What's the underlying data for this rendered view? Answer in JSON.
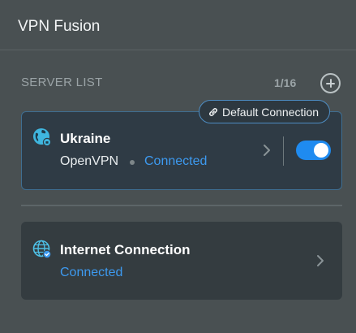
{
  "header": {
    "title": "VPN Fusion"
  },
  "server_list": {
    "label": "SERVER LIST",
    "count": "1/16",
    "add_icon": "plus-circle-icon"
  },
  "default_badge": {
    "label": "Default Connection",
    "icon": "link-icon"
  },
  "servers": [
    {
      "name": "Ukraine",
      "protocol": "OpenVPN",
      "status": "Connected",
      "icon": "globe-vpn-icon",
      "enabled": true
    }
  ],
  "internet": {
    "name": "Internet Connection",
    "status": "Connected",
    "icon": "globe-check-icon"
  },
  "colors": {
    "accent": "#1f8bf0",
    "status_text": "#3d9af0",
    "background": "#495052",
    "card_active": "#2f3b45",
    "card": "#343c40"
  }
}
